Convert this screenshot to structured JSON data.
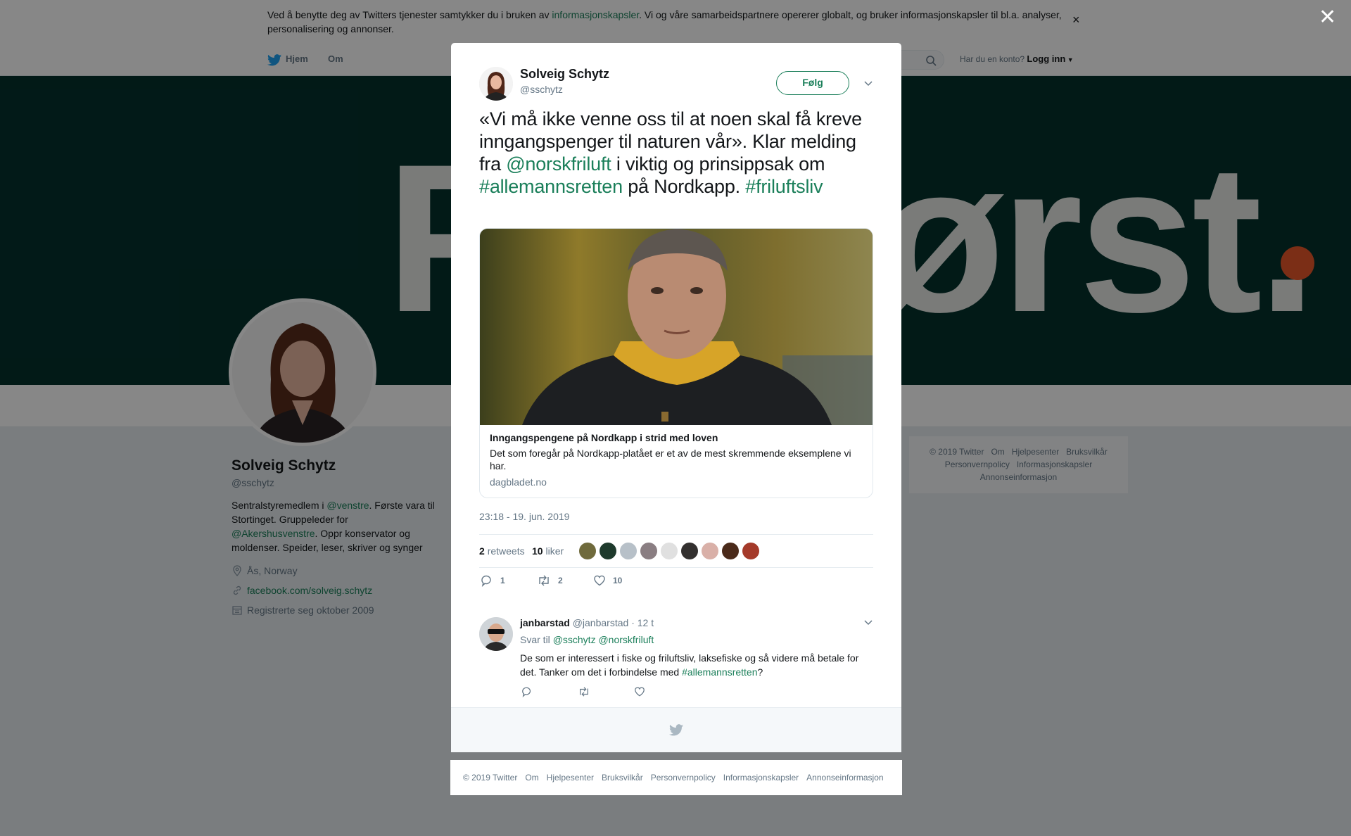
{
  "cookie_banner": {
    "text_before": "Ved å benytte deg av Twitters tjenester samtykker du i bruken av ",
    "link": "informasjonskapsler",
    "text_after": ". Vi og våre samarbeidspartnere opererer globalt, og bruker informasjonskapsler til bl.a. analyser, personalisering og annonser.",
    "close": "×"
  },
  "nav": {
    "home": "Hjem",
    "about": "Om",
    "account_prompt": "Har du en konto?",
    "login": "Logg inn"
  },
  "banner": {
    "text_left": "F",
    "text_right": "ørst.",
    "accent_color": "#e8572a",
    "bg_color": "#04312d"
  },
  "profile": {
    "name": "Solveig Schytz",
    "handle": "@sschytz",
    "bio_1": "Sentralstyremedlem i ",
    "bio_link_1": "@venstre",
    "bio_2": ". Første vara til Stortinget. Gruppeleder for ",
    "bio_link_2": "@Akershusvenstre",
    "bio_3": ". Oppr konservator og moldenser. Speider, leser, skriver og synger",
    "location": "Ås, Norway",
    "website": "facebook.com/solveig.schytz",
    "joined": "Registrerte seg oktober 2009"
  },
  "right_footer": {
    "items": [
      "© 2019 Twitter",
      "Om",
      "Hjelpesenter",
      "Bruksvilkår",
      "Personvernpolicy",
      "Informasjonskapsler",
      "Annonseinformasjon"
    ]
  },
  "modal": {
    "close": "✕",
    "author_name": "Solveig Schytz",
    "author_handle": "@sschytz",
    "follow_label": "Følg",
    "tweet": {
      "t1": "«Vi må ikke venne oss til at noen skal få kreve inngangspenger til naturen vår».  Klar melding fra ",
      "mention": "@norskfriluft",
      "t2": " i viktig og prinsippsak om ",
      "hashtag1": "#allemannsretten",
      "t3": " på Nordkapp. ",
      "hashtag2": "#friluftsliv"
    },
    "card": {
      "title": "Inngangspengene på Nordkapp i strid med loven",
      "description": "Det som foregår på Nordkapp-platået er et av de mest skremmende eksemplene vi har.",
      "domain": "dagbladet.no"
    },
    "timestamp": "23:18 - 19. jun. 2019",
    "stats": {
      "retweets_count": "2",
      "retweets_label": "retweets",
      "likes_count": "10",
      "likes_label": "liker"
    },
    "actions": {
      "replies": "1",
      "retweets": "2",
      "likes": "10"
    },
    "reply": {
      "name": "janbarstad",
      "handle": "@janbarstad",
      "time": "· 12 t",
      "reply_to_label": "Svar til",
      "reply_to_1": "@sschytz",
      "reply_to_2": "@norskfriluft",
      "text_1": "De som er interessert i fiske og friluftsliv, laksefiske og så videre må betale for det. Tanker om det i forbindelse med ",
      "hashtag": "#allemannsretten",
      "text_2": "?"
    }
  },
  "bottom_footer": {
    "items": [
      "© 2019 Twitter",
      "Om",
      "Hjelpesenter",
      "Bruksvilkår",
      "Personvernpolicy",
      "Informasjonskapsler",
      "Annonseinformasjon"
    ]
  },
  "colors": {
    "link": "#1b7f5a",
    "overlay": "rgba(0,0,0,0.47)"
  }
}
